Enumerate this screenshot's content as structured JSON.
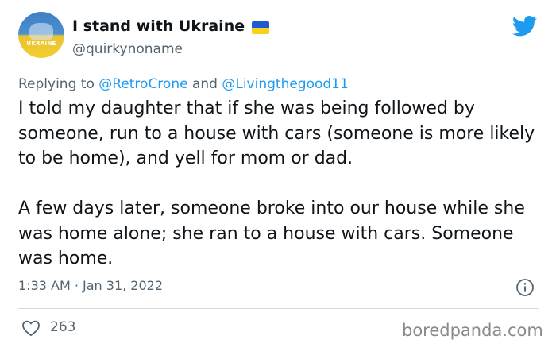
{
  "author": {
    "display_name": "I stand with Ukraine",
    "handle": "@quirkynoname",
    "avatar_text": "UKRAINE",
    "flag_colors": [
      "#1e5bd3",
      "#f7d21c"
    ]
  },
  "reply": {
    "prefix": "Replying to",
    "mention_1": "@RetroCrone",
    "conjunction": "and",
    "mention_2": "@Livingthegood11"
  },
  "body": {
    "paragraph_1": "I told my daughter that if she was being followed by someone, run to a house with cars (someone is more likely to be home), and yell for mom or dad.",
    "paragraph_2": "A few days later, someone broke into our house while she was home alone; she ran to a house with cars. Someone was home."
  },
  "meta": {
    "timestamp": "1:33 AM · Jan 31, 2022",
    "like_count": "263"
  },
  "icons": {
    "brand": "twitter-bird-icon",
    "info": "info-icon",
    "like": "heart-icon"
  },
  "colors": {
    "twitter_blue": "#1d9bf0",
    "text_primary": "#0f1419",
    "text_secondary": "#536471"
  },
  "watermark": "boredpanda.com"
}
